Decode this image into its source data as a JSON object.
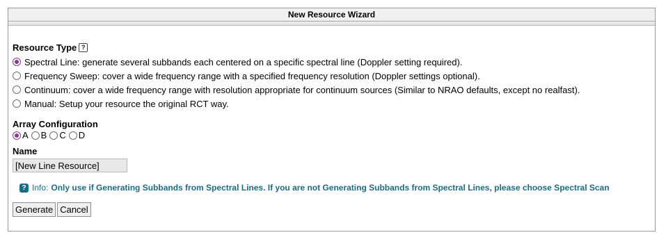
{
  "window": {
    "title": "New Resource Wizard"
  },
  "resource_type": {
    "label": "Resource Type",
    "help_icon": "question-icon",
    "selected": "spectral_line",
    "options": [
      {
        "id": "spectral_line",
        "label": "Spectral Line: generate several subbands each centered on a specific spectral line (Doppler setting required)."
      },
      {
        "id": "frequency_sweep",
        "label": "Frequency Sweep: cover a wide frequency range with a specified frequency resolution (Doppler settings optional)."
      },
      {
        "id": "continuum",
        "label": "Continuum: cover a wide frequency range with resolution appropriate for continuum sources (Similar to NRAO defaults, except no realfast)."
      },
      {
        "id": "manual",
        "label": "Manual: Setup your resource the original RCT way."
      }
    ]
  },
  "array_configuration": {
    "label": "Array Configuration",
    "selected": "A",
    "options": [
      "A",
      "B",
      "C",
      "D"
    ]
  },
  "name": {
    "label": "Name",
    "value": "[New Line Resource]"
  },
  "info": {
    "prefix": "Info:",
    "message": "Only use if Generating Subbands from Spectral Lines. If you are not Generating Subbands from Spectral Lines, please choose Spectral Scan"
  },
  "buttons": {
    "generate": "Generate",
    "cancel": "Cancel"
  },
  "colors": {
    "accent": "#8a3b8f",
    "info": "#186d84"
  }
}
